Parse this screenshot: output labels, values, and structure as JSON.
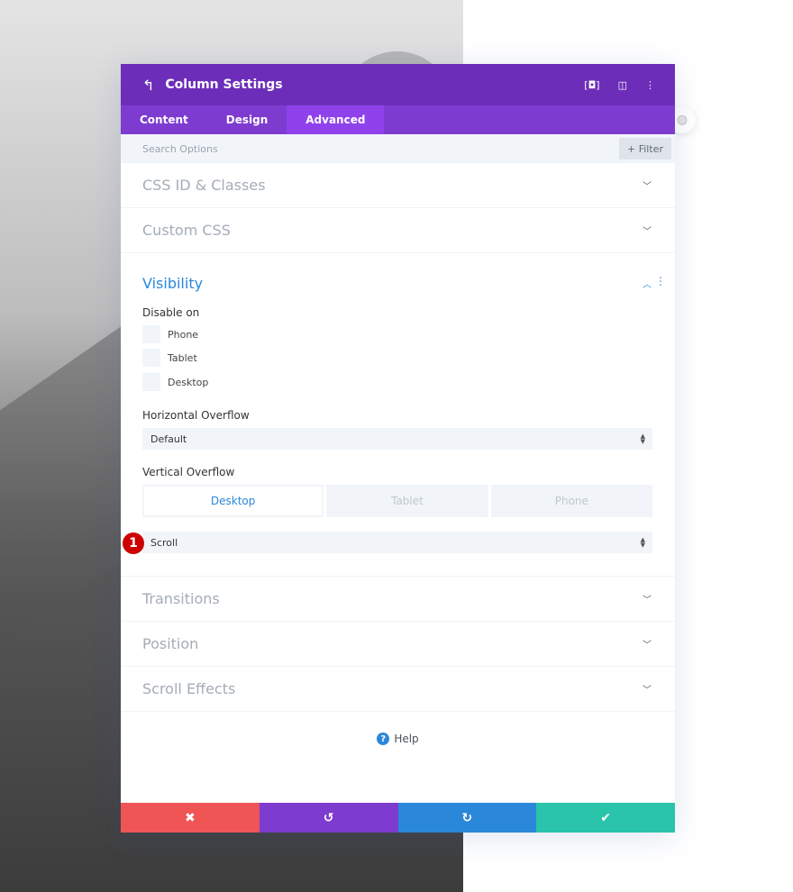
{
  "header": {
    "title": "Column Settings"
  },
  "tabs": [
    {
      "label": "Content"
    },
    {
      "label": "Design"
    },
    {
      "label": "Advanced"
    }
  ],
  "search": {
    "placeholder": "Search Options",
    "filter_label": "+ Filter"
  },
  "sections": {
    "css_id": "CSS ID & Classes",
    "custom_css": "Custom CSS",
    "visibility": "Visibility",
    "transitions": "Transitions",
    "position": "Position",
    "scroll_effects": "Scroll Effects"
  },
  "visibility": {
    "disable_on_label": "Disable on",
    "options": [
      "Phone",
      "Tablet",
      "Desktop"
    ],
    "horizontal_overflow_label": "Horizontal Overflow",
    "horizontal_overflow_value": "Default",
    "vertical_overflow_label": "Vertical Overflow",
    "device_tabs": [
      "Desktop",
      "Tablet",
      "Phone"
    ],
    "vertical_overflow_value": "Scroll"
  },
  "badge": "1",
  "help_label": "Help",
  "colors": {
    "header": "#6c2eb9",
    "tabs": "#7e3bd0",
    "accent": "#2b87da",
    "cancel": "#ef5555",
    "undo": "#7e3bd0",
    "redo": "#2b87da",
    "save": "#29c4a9"
  }
}
